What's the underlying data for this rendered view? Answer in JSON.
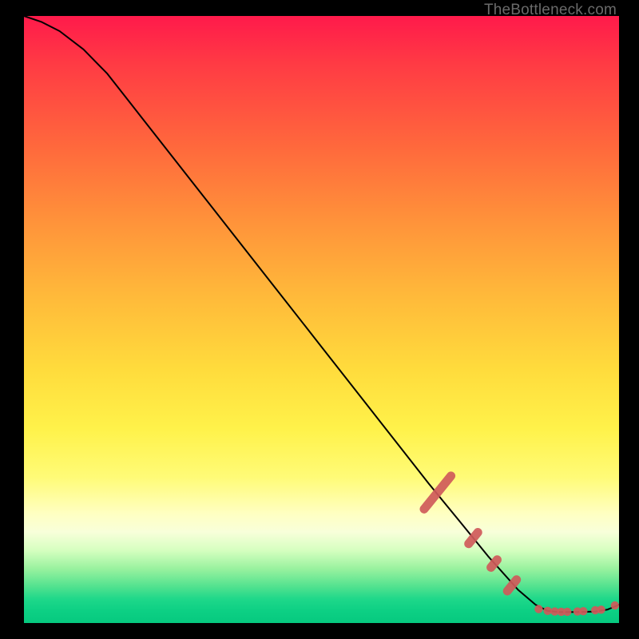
{
  "watermark": "TheBottleneck.com",
  "chart_data": {
    "type": "line",
    "title": "",
    "xlabel": "",
    "ylabel": "",
    "xlim": [
      0,
      100
    ],
    "ylim": [
      0,
      100
    ],
    "curve": [
      {
        "x": 0,
        "y": 100
      },
      {
        "x": 3,
        "y": 99
      },
      {
        "x": 6,
        "y": 97.5
      },
      {
        "x": 10,
        "y": 94.5
      },
      {
        "x": 14,
        "y": 90.5
      },
      {
        "x": 20,
        "y": 83
      },
      {
        "x": 30,
        "y": 70.5
      },
      {
        "x": 40,
        "y": 58
      },
      {
        "x": 50,
        "y": 45.5
      },
      {
        "x": 60,
        "y": 33
      },
      {
        "x": 68,
        "y": 23
      },
      {
        "x": 73,
        "y": 17
      },
      {
        "x": 78,
        "y": 11
      },
      {
        "x": 83,
        "y": 5.5
      },
      {
        "x": 86,
        "y": 3
      },
      {
        "x": 88,
        "y": 2
      },
      {
        "x": 90,
        "y": 1.8
      },
      {
        "x": 93,
        "y": 1.8
      },
      {
        "x": 96,
        "y": 1.9
      },
      {
        "x": 98,
        "y": 2.2
      },
      {
        "x": 100,
        "y": 3
      }
    ],
    "marker_clusters": [
      {
        "cx": 69.5,
        "cy": 21.5,
        "len": 11,
        "angle": -51
      },
      {
        "cx": 75.5,
        "cy": 14.0,
        "len": 5,
        "angle": -51
      },
      {
        "cx": 79.0,
        "cy": 9.8,
        "len": 4,
        "angle": -51
      },
      {
        "cx": 82.0,
        "cy": 6.2,
        "len": 5,
        "angle": -51
      }
    ],
    "flat_markers": [
      {
        "x": 86.5,
        "y": 2.3
      },
      {
        "x": 88.0,
        "y": 2.0
      },
      {
        "x": 89.2,
        "y": 1.9
      },
      {
        "x": 90.3,
        "y": 1.85
      },
      {
        "x": 91.3,
        "y": 1.85
      },
      {
        "x": 93.0,
        "y": 1.9
      },
      {
        "x": 94.0,
        "y": 1.95
      },
      {
        "x": 96.0,
        "y": 2.1
      },
      {
        "x": 97.0,
        "y": 2.2
      },
      {
        "x": 99.3,
        "y": 2.9
      }
    ],
    "colors": {
      "curve": "#000000",
      "marker_fill": "#cf5a5a",
      "marker_stroke": "#cf5a5a"
    }
  }
}
